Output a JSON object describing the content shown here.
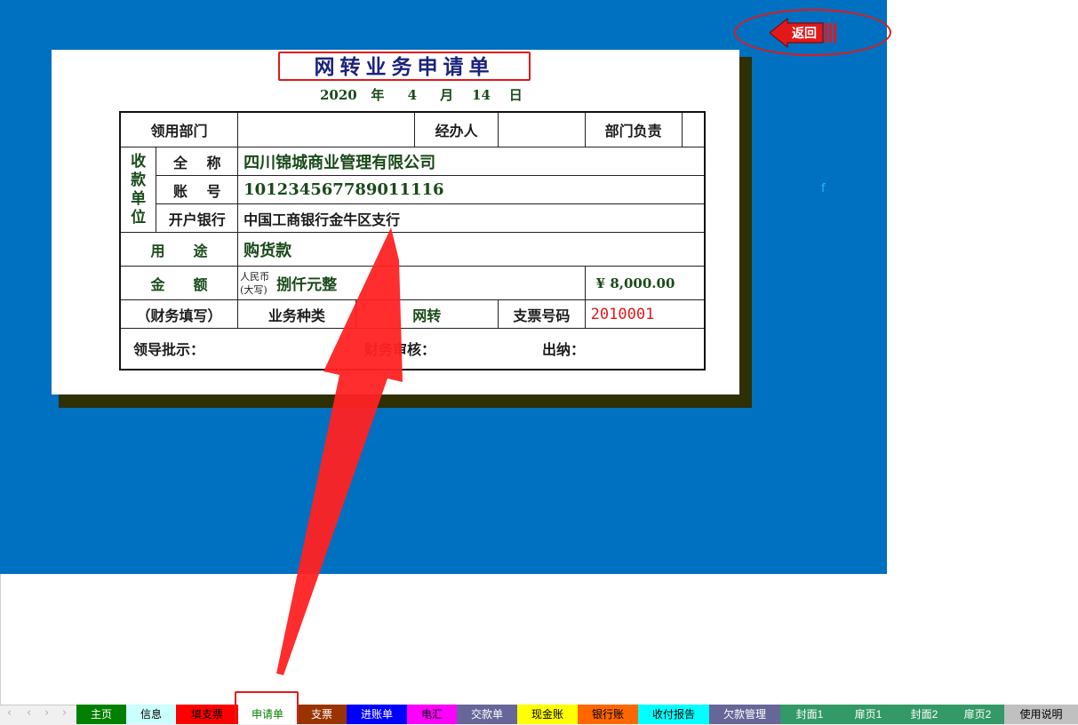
{
  "form": {
    "title": "网转业务申请单",
    "date": {
      "year": "2020",
      "year_unit": "年",
      "month": "4",
      "month_unit": "月",
      "day": "14",
      "day_unit": "日"
    },
    "row1": {
      "dept_label": "领用部门",
      "dept_value": "",
      "handler_label": "经办人",
      "handler_value": "",
      "head_label": "部门负责",
      "head_value": ""
    },
    "payee_label": [
      "收",
      "款",
      "单",
      "位"
    ],
    "payee": {
      "name_label": "全　 称",
      "name_value": "四川锦城商业管理有限公司",
      "acct_label": "账　 号",
      "acct_value": "101234567789011116",
      "bank_label": "开户银行",
      "bank_value": "中国工商银行金牛区支行"
    },
    "purpose": {
      "label": "用　　途",
      "value": "购货款"
    },
    "amount": {
      "label": "金　　额",
      "rmb_label": "人民币",
      "caps_label": "(大写)",
      "caps_value": "捌仟元整",
      "number": "¥ 8,000.00"
    },
    "finance": {
      "label": "（财务填写）",
      "biz_type_label": "业务种类",
      "biz_type_value": "网转",
      "check_label": "支票号码",
      "check_value": "2010001"
    },
    "sign": {
      "leader": "领导批示：",
      "audit": "财务审核：",
      "cashier": "出纳："
    }
  },
  "back_button": {
    "label": "返回",
    "color": "#e31919"
  },
  "cell_marker": "f",
  "tabs": [
    {
      "label": "主页",
      "bg": "#008000",
      "fg": "#ffffff"
    },
    {
      "label": "信息",
      "bg": "#ccffff",
      "fg": "#000000"
    },
    {
      "label": "填支票",
      "bg": "#ff0000",
      "fg": "#000000"
    },
    {
      "label": "申请单",
      "bg": "#ffffff",
      "fg": "#008000"
    },
    {
      "label": "支票",
      "bg": "#993300",
      "fg": "#ffffff"
    },
    {
      "label": "进账单",
      "bg": "#0000ff",
      "fg": "#ffffff"
    },
    {
      "label": "电汇",
      "bg": "#ff00ff",
      "fg": "#000000"
    },
    {
      "label": "交款单",
      "bg": "#666699",
      "fg": "#ffffff"
    },
    {
      "label": "现金账",
      "bg": "#ffff00",
      "fg": "#000000"
    },
    {
      "label": "银行账",
      "bg": "#ff6600",
      "fg": "#000000"
    },
    {
      "label": "收付报告",
      "bg": "#00ffff",
      "fg": "#000000"
    },
    {
      "label": "欠款管理",
      "bg": "#666699",
      "fg": "#ffffff"
    },
    {
      "label": "封面1",
      "bg": "#339966",
      "fg": "#ffffff"
    },
    {
      "label": "扉页1",
      "bg": "#339966",
      "fg": "#ffffff"
    },
    {
      "label": "封面2",
      "bg": "#339966",
      "fg": "#ffffff"
    },
    {
      "label": "扉页2",
      "bg": "#339966",
      "fg": "#ffffff"
    },
    {
      "label": "使用说明",
      "bg": "#c0c0c0",
      "fg": "#000000"
    }
  ],
  "nav_arrows": [
    "‹",
    "‹",
    "›",
    "›"
  ],
  "colors": {
    "sheet_blue": "#0070c0",
    "shadow": "#2f2f05",
    "highlight_red": "#e31919"
  }
}
